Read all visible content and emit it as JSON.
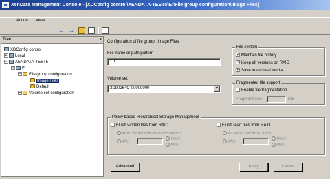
{
  "window": {
    "title": "XenData Management Console - [XDConfig control\\XENDATA-TEST5\\E:\\File group configuration\\Image Files]"
  },
  "menu": {
    "action": "Action",
    "view": "View"
  },
  "toolbar": {
    "back_icon": "back-arrow-icon",
    "forward_icon": "forward-arrow-icon"
  },
  "tree": {
    "header": "Tree",
    "close_glyph": "x",
    "nodes": [
      {
        "label": "XDConfig control",
        "icon": "computer-icon"
      },
      {
        "label": "Local",
        "icon": "computer-icon"
      },
      {
        "label": "XENDATA-TEST5",
        "icon": "computer-icon"
      },
      {
        "label": "E:",
        "icon": "drive-icon"
      },
      {
        "label": "File group configuration",
        "icon": "folder-icon"
      },
      {
        "label": "Image Files",
        "icon": "file-group-icon",
        "selected": true
      },
      {
        "label": "Default",
        "icon": "file-group-icon"
      },
      {
        "label": "Volume set configuration",
        "icon": "folder-icon"
      }
    ]
  },
  "config": {
    "heading_prefix": "Configuration of file group",
    "heading_name": "Image Files",
    "path_label": "File name or path pattern",
    "path_value": "*.tif",
    "volume_label": "Volume set",
    "volume_value": "3D90264C-00000000"
  },
  "file_system": {
    "title": "File system",
    "maintain_history": {
      "label": "Maintain file history",
      "checked": true
    },
    "keep_versions": {
      "label": "Keep all versions on RAID",
      "checked": true
    },
    "save_archival": {
      "label": "Save to archival media",
      "checked": true
    }
  },
  "fragmented": {
    "title": "Fragmented file support",
    "enable_label": "Enable file fragmentation",
    "size_label": "Fragment size",
    "size_unit": "MB",
    "size_value": ""
  },
  "policy": {
    "title": "Policy based Hierarchical Storage Management",
    "flush_written": "Flush written files from RAID",
    "flush_read": "Flush read files from RAID",
    "written_radio1": "When the last replica has been written",
    "read_radio1": "As soon as the file is closed",
    "after_label": "After",
    "hours_label": "Hours",
    "mins_label": "Mins"
  },
  "buttons": {
    "advanced": "Advanced",
    "apply": "Apply",
    "cancel": "Cancel"
  },
  "colors": {
    "title_start": "#1b3f8f",
    "title_end": "#a6c4ef",
    "selection": "#0a246a",
    "face": "#d4d0c8"
  }
}
